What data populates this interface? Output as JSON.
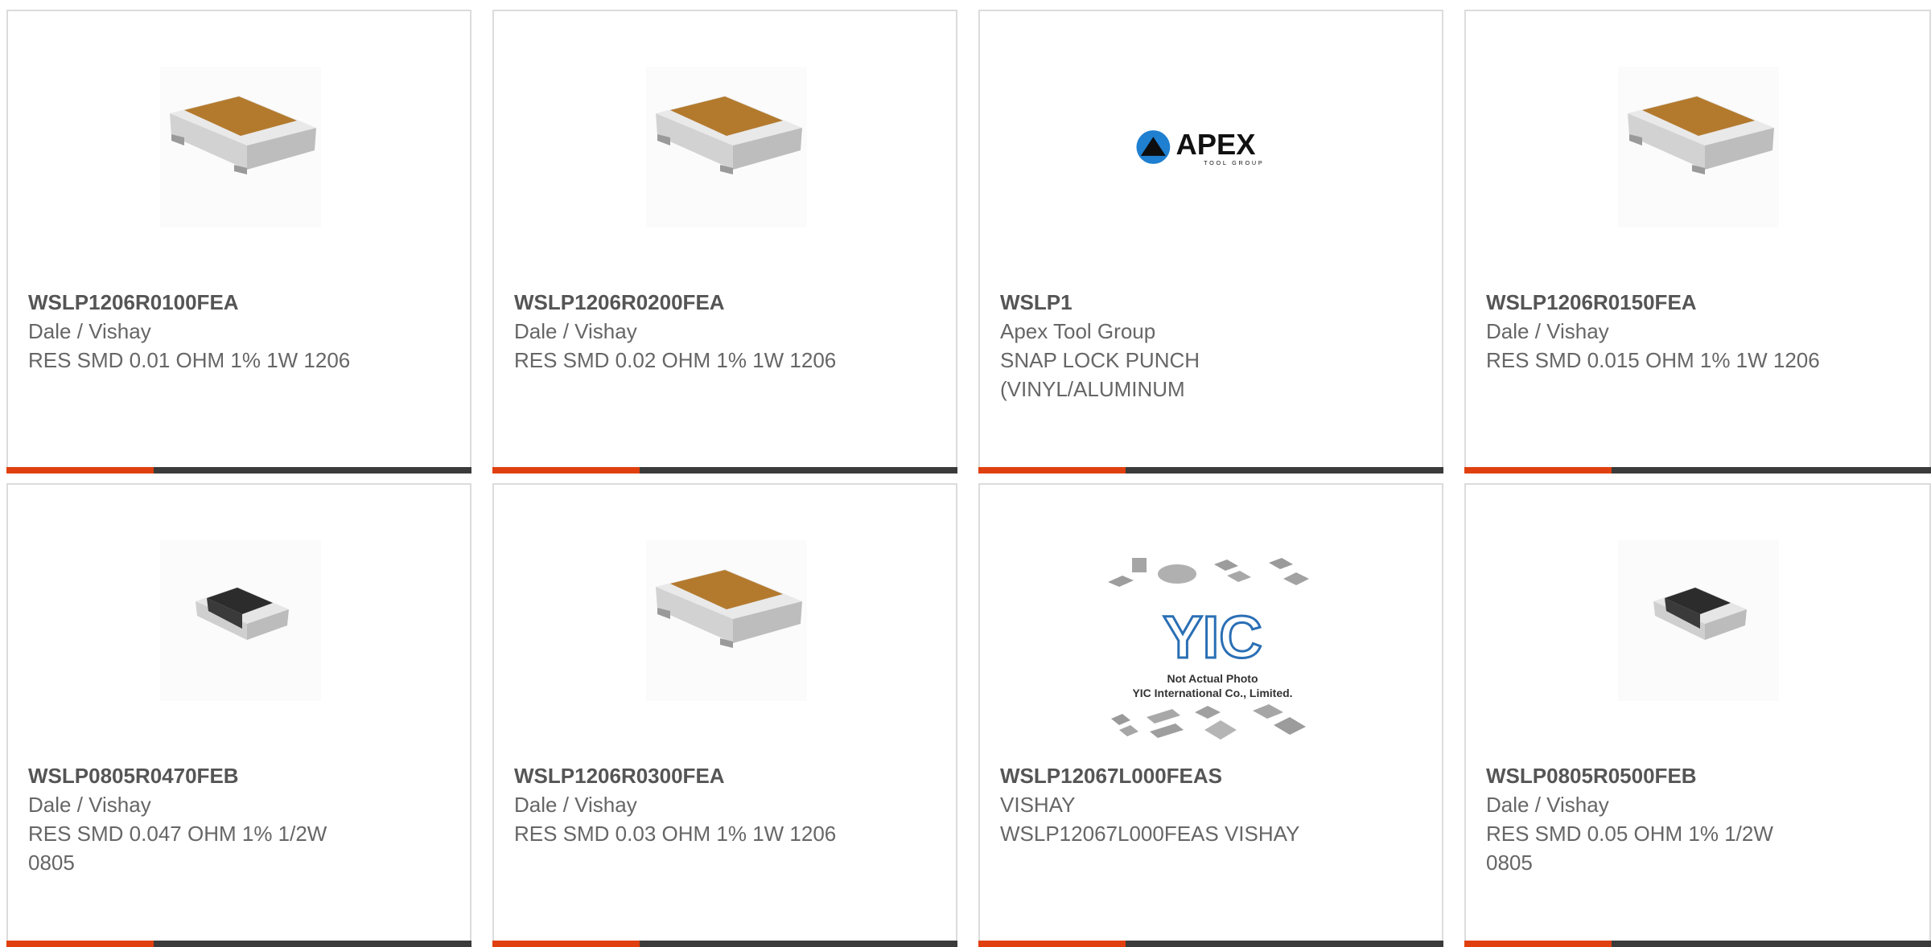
{
  "colors": {
    "accent": "#e0400f",
    "bar": "#3b3b3b",
    "border": "#dcdcdc",
    "text": "#666666"
  },
  "products": [
    {
      "part_number": "WSLP1206R0100FEA",
      "manufacturer": "Dale / Vishay",
      "description": "RES SMD 0.01 OHM 1% 1W 1206",
      "image": "chip-resistor-1206-icon"
    },
    {
      "part_number": "WSLP1206R0200FEA",
      "manufacturer": "Dale / Vishay",
      "description": "RES SMD 0.02 OHM 1% 1W 1206",
      "image": "chip-resistor-1206-icon"
    },
    {
      "part_number": "WSLP1",
      "manufacturer": "Apex Tool Group",
      "description": "SNAP LOCK PUNCH (VINYL/ALUMINUM",
      "image": "apex-logo",
      "logo_text": "APEX",
      "logo_subtext": "TOOL GROUP"
    },
    {
      "part_number": "WSLP1206R0150FEA",
      "manufacturer": "Dale / Vishay",
      "description": "RES SMD 0.015 OHM 1% 1W 1206",
      "image": "chip-resistor-1206-icon"
    },
    {
      "part_number": "WSLP0805R0470FEB",
      "manufacturer": "Dale / Vishay",
      "description": "RES SMD 0.047 OHM 1% 1/2W 0805",
      "image": "chip-resistor-0805-icon"
    },
    {
      "part_number": "WSLP1206R0300FEA",
      "manufacturer": "Dale / Vishay",
      "description": "RES SMD 0.03 OHM 1% 1W 1206",
      "image": "chip-resistor-1206-icon"
    },
    {
      "part_number": "WSLP12067L000FEAS",
      "manufacturer": "VISHAY",
      "description": "WSLP12067L000FEAS VISHAY",
      "image": "yic-placeholder",
      "logo_text": "YIC",
      "caption_line1": "Not Actual Photo",
      "caption_line2": "YIC International Co., Limited."
    },
    {
      "part_number": "WSLP0805R0500FEB",
      "manufacturer": "Dale / Vishay",
      "description": "RES SMD 0.05 OHM 1% 1/2W 0805",
      "image": "chip-resistor-0805-icon"
    }
  ]
}
